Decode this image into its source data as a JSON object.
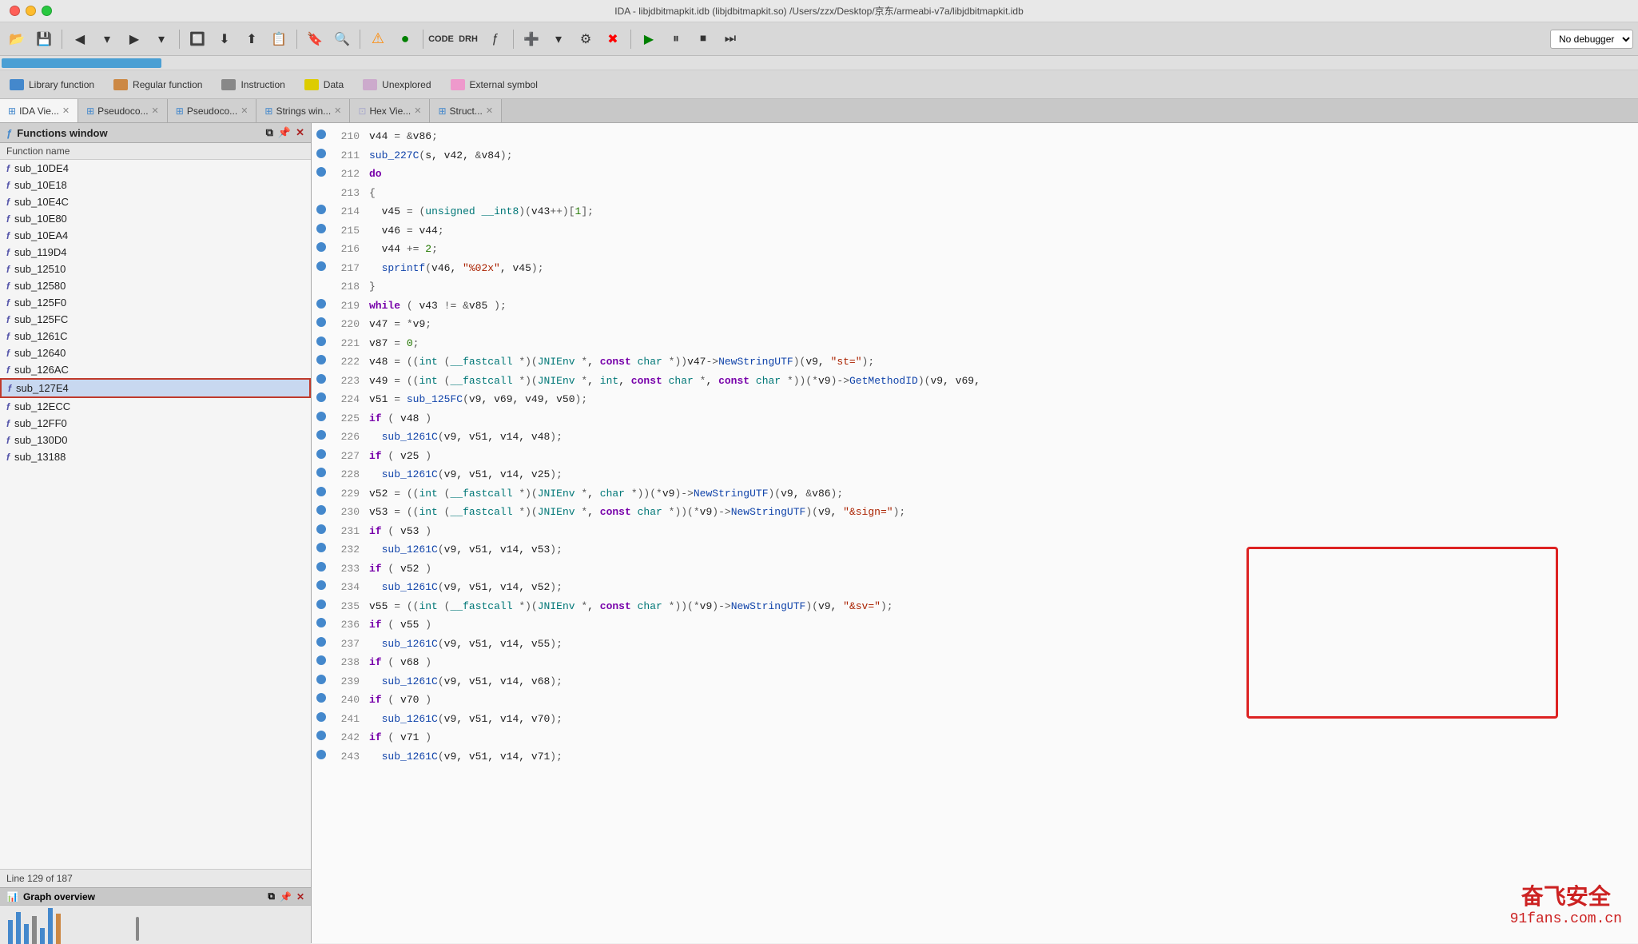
{
  "titlebar": {
    "title": "IDA - libjdbitmapkit.idb (libjdbitmapkit.so) /Users/zzx/Desktop/京东/armeabi-v7a/libjdbitmapkit.idb"
  },
  "toolbar": {
    "debugger_label": "No debugger"
  },
  "legend": {
    "items": [
      {
        "label": "Library function",
        "color": "#4488cc"
      },
      {
        "label": "Regular function",
        "color": "#cc8844"
      },
      {
        "label": "Instruction",
        "color": "#888888"
      },
      {
        "label": "Data",
        "color": "#ddcc00"
      },
      {
        "label": "Unexplored",
        "color": "#ccaacc"
      },
      {
        "label": "External symbol",
        "color": "#ee99cc"
      }
    ]
  },
  "tabs": [
    {
      "id": "functions-win",
      "label": "Functions window",
      "active": false,
      "closeable": false
    },
    {
      "id": "ida-view",
      "label": "IDA Vie...",
      "active": true,
      "closeable": true
    },
    {
      "id": "pseudocode-1",
      "label": "Pseudoco...",
      "active": false,
      "closeable": true
    },
    {
      "id": "pseudocode-2",
      "label": "Pseudoco...",
      "active": false,
      "closeable": true
    },
    {
      "id": "strings-win",
      "label": "Strings win...",
      "active": false,
      "closeable": true
    },
    {
      "id": "hex-view",
      "label": "Hex Vie...",
      "active": false,
      "closeable": true
    },
    {
      "id": "struct",
      "label": "Struct...",
      "active": false,
      "closeable": true
    }
  ],
  "functions_panel": {
    "title": "Functions window",
    "subheader": "Function name",
    "items": [
      "sub_10DE4",
      "sub_10E18",
      "sub_10E4C",
      "sub_10E80",
      "sub_10EA4",
      "sub_119D4",
      "sub_12510",
      "sub_12580",
      "sub_125F0",
      "sub_125FC",
      "sub_1261C",
      "sub_12640",
      "sub_126AC",
      "sub_127E4",
      "sub_12ECC",
      "sub_12FF0",
      "sub_130D0",
      "sub_13188"
    ],
    "selected": "sub_127E4",
    "footer": "Line 129 of 187"
  },
  "graph_overview": {
    "title": "Graph overview"
  },
  "code_lines": [
    {
      "num": "210",
      "text": "  v44 = &v86;"
    },
    {
      "num": "211",
      "text": "  sub_227C(s, v42, &v84);"
    },
    {
      "num": "212",
      "text": "  do"
    },
    {
      "num": "213",
      "text": "  {"
    },
    {
      "num": "214",
      "text": "    v45 = (unsigned __int8)(v43++)[1];"
    },
    {
      "num": "215",
      "text": "    v46 = v44;"
    },
    {
      "num": "216",
      "text": "    v44 += 2;"
    },
    {
      "num": "217",
      "text": "    sprintf(v46, \"%02x\", v45);"
    },
    {
      "num": "218",
      "text": "  }"
    },
    {
      "num": "219",
      "text": "  while ( v43 != &v85 );"
    },
    {
      "num": "220",
      "text": "  v47 = *v9;"
    },
    {
      "num": "221",
      "text": "  v87 = 0;"
    },
    {
      "num": "222",
      "text": "  v48 = ((int (__fastcall *)(JNIEnv *, const char *))v47->NewStringUTF)(v9, \"st=\");"
    },
    {
      "num": "223",
      "text": "  v49 = ((int (__fastcall *)(JNIEnv *, int, const char *, const char *))(*v9)->GetMethodID)(v9, v69,"
    },
    {
      "num": "224",
      "text": "  v51 = sub_125FC(v9, v69, v49, v50);"
    },
    {
      "num": "225",
      "text": "  if ( v48 )"
    },
    {
      "num": "226",
      "text": "    sub_1261C(v9, v51, v14, v48);"
    },
    {
      "num": "227",
      "text": "  if ( v25 )"
    },
    {
      "num": "228",
      "text": "    sub_1261C(v9, v51, v14, v25);"
    },
    {
      "num": "229",
      "text": "  v52 = ((int (__fastcall *)(JNIEnv *, char *))(*v9)->NewStringUTF)(v9, &v86);"
    },
    {
      "num": "230",
      "text": "  v53 = ((int (__fastcall *)(JNIEnv *, const char *))(*v9)->NewStringUTF)(v9, \"&sign=\");"
    },
    {
      "num": "231",
      "text": "  if ( v53 )"
    },
    {
      "num": "232",
      "text": "    sub_1261C(v9, v51, v14, v53);"
    },
    {
      "num": "233",
      "text": "  if ( v52 )"
    },
    {
      "num": "234",
      "text": "    sub_1261C(v9, v51, v14, v52);"
    },
    {
      "num": "235",
      "text": "  v55 = ((int (__fastcall *)(JNIEnv *, const char *))(*v9)->NewStringUTF)(v9, \"&sv=\");"
    },
    {
      "num": "236",
      "text": "  if ( v55 )"
    },
    {
      "num": "237",
      "text": "    sub_1261C(v9, v51, v14, v55);"
    },
    {
      "num": "238",
      "text": "  if ( v68 )"
    },
    {
      "num": "239",
      "text": "    sub_1261C(v9, v51, v14, v68);"
    },
    {
      "num": "240",
      "text": "  if ( v70 )"
    },
    {
      "num": "241",
      "text": "    sub_1261C(v9, v51, v14, v70);"
    },
    {
      "num": "242",
      "text": "  if ( v71 )"
    },
    {
      "num": "243",
      "text": "    sub_1261C(v9, v51, v14, v71);"
    }
  ],
  "watermark": {
    "cn": "奋飞安全",
    "en": "91fans.com.cn"
  }
}
